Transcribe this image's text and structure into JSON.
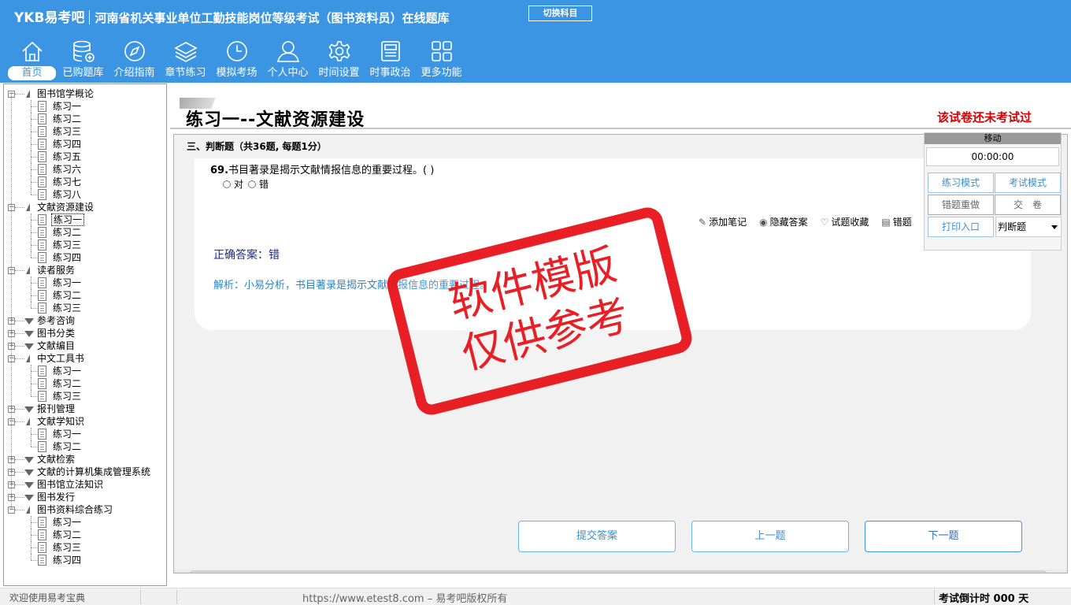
{
  "header": {
    "brand": "YKB易考吧",
    "title": "河南省机关事业单位工勤技能岗位等级考试（图书资料员）在线题库",
    "switch_label": "切换科目"
  },
  "toolbar": [
    {
      "label": "首页",
      "icon": "home-icon"
    },
    {
      "label": "已购题库",
      "icon": "database-icon"
    },
    {
      "label": "介绍指南",
      "icon": "compass-icon"
    },
    {
      "label": "章节练习",
      "icon": "layers-icon"
    },
    {
      "label": "模拟考场",
      "icon": "clock-icon"
    },
    {
      "label": "个人中心",
      "icon": "user-icon"
    },
    {
      "label": "时间设置",
      "icon": "gear-icon"
    },
    {
      "label": "时事政治",
      "icon": "newspaper-icon"
    },
    {
      "label": "更多功能",
      "icon": "grid-icon"
    }
  ],
  "tree": [
    {
      "label": "图书馆学概论",
      "open": true,
      "children": [
        "练习一",
        "练习二",
        "练习三",
        "练习四",
        "练习五",
        "练习六",
        "练习七",
        "练习八"
      ]
    },
    {
      "label": "文献资源建设",
      "open": true,
      "children": [
        "练习一",
        "练习二",
        "练习三",
        "练习四"
      ],
      "selected": 0
    },
    {
      "label": "读者服务",
      "open": true,
      "children": [
        "练习一",
        "练习二",
        "练习三"
      ]
    },
    {
      "label": "参考咨询",
      "open": false,
      "children": []
    },
    {
      "label": "图书分类",
      "open": false,
      "children": []
    },
    {
      "label": "文献编目",
      "open": false,
      "children": []
    },
    {
      "label": "中文工具书",
      "open": true,
      "children": [
        "练习一",
        "练习二",
        "练习三"
      ]
    },
    {
      "label": "报刊管理",
      "open": false,
      "children": []
    },
    {
      "label": "文献学知识",
      "open": true,
      "children": [
        "练习一",
        "练习二"
      ]
    },
    {
      "label": "文献检索",
      "open": false,
      "children": []
    },
    {
      "label": "文献的计算机集成管理系统",
      "open": false,
      "children": []
    },
    {
      "label": "图书馆立法知识",
      "open": false,
      "children": []
    },
    {
      "label": "图书发行",
      "open": false,
      "children": []
    },
    {
      "label": "图书资料综合练习",
      "open": true,
      "children": [
        "练习一",
        "练习二",
        "练习三",
        "练习四"
      ]
    }
  ],
  "main": {
    "title": "练习一--文献资源建设",
    "exam_status": "该试卷还未考试过",
    "section": "三、判断题（共36题, 每题1分）",
    "question_number": "69.",
    "question_text": "书目著录是揭示文献情报信息的重要过程。( )",
    "options": [
      "对",
      "错"
    ],
    "actions": [
      {
        "label": "添加笔记",
        "icon": "pencil-icon"
      },
      {
        "label": "隐藏答案",
        "icon": "eye-icon"
      },
      {
        "label": "试题收藏",
        "icon": "heart-icon"
      },
      {
        "label": "错题",
        "icon": "notebook-icon"
      }
    ],
    "answer": "正确答案：错",
    "analysis": "解析：小易分析，书目著录是揭示文献情报信息的重要过程。",
    "buttons": {
      "submit": "提交答案",
      "prev": "上一题",
      "next": "下一题"
    }
  },
  "panel": {
    "move": "移动",
    "timer": "00:00:00",
    "practice_mode": "练习模式",
    "exam_mode": "考试模式",
    "redo_wrong": "错题重做",
    "hand_in": "交　卷",
    "print": "打印入口",
    "question_type": "判断题"
  },
  "stamp": {
    "line1": "软件模版",
    "line2": "仅供参考"
  },
  "statusbar": {
    "left": "欢迎使用易考宝典",
    "center": "https://www.etest8.com – 易考吧版权所有",
    "right": "考试倒计时 000 天"
  }
}
